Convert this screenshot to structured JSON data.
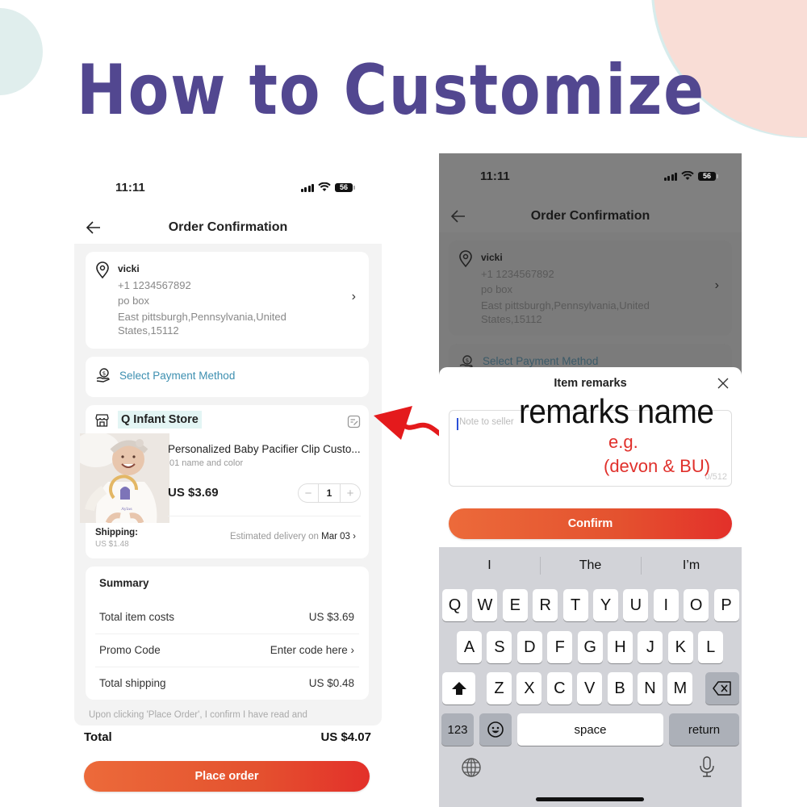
{
  "headline": "How to Customize",
  "colors": {
    "headline": "#524790",
    "accent_gradient_start": "#ec6a3a",
    "accent_gradient_end": "#e3302a",
    "payment_link": "#3d8fb0",
    "annotation_red": "#e0302b"
  },
  "status_bar": {
    "time": "11:11",
    "battery": "56",
    "icons": [
      "signal-icon",
      "wifi-icon",
      "battery-icon"
    ]
  },
  "left_phone": {
    "nav": {
      "title": "Order Confirmation",
      "back_icon": "arrow-left-icon"
    },
    "address": {
      "name": "vicki",
      "phone": "+1 1234567892",
      "line1": "po box",
      "line2": "East pittsburgh,Pennsylvania,United",
      "line3": "States,15112",
      "icon": "location-pin-icon"
    },
    "payment": {
      "label": "Select Payment Method",
      "icon": "hand-dollar-icon"
    },
    "store": {
      "name": "Q Infant Store",
      "icon": "store-icon",
      "note_icon": "edit-note-icon",
      "product": {
        "title": "Personalized Baby Pacifier Clip Custo...",
        "variant": "01 name and color",
        "price": "US $3.69",
        "quantity": "1",
        "minus": "−",
        "plus": "+"
      },
      "shipping_label": "Shipping:",
      "shipping_value": "US $1.48",
      "delivery_prefix": "Estimated delivery on",
      "delivery_date": "Mar 03",
      "chevron": "›"
    },
    "summary": {
      "title": "Summary",
      "rows": [
        {
          "label": "Total item costs",
          "value": "US $3.69"
        },
        {
          "label": "Promo Code",
          "value": "Enter code here ›"
        },
        {
          "label": "Total shipping",
          "value": "US $0.48"
        }
      ]
    },
    "legal_text": "Upon clicking 'Place Order', I confirm I have read and",
    "total_label": "Total",
    "total_value": "US $4.07",
    "place_order": "Place order"
  },
  "right_phone": {
    "nav": {
      "title": "Order Confirmation"
    },
    "address": {
      "name": "vicki",
      "phone": "+1 1234567892",
      "line1": "po box",
      "line2": "East pittsburgh,Pennsylvania,United",
      "line3": "States,15112"
    },
    "payment_label": "Select Payment Method",
    "sheet": {
      "title": "Item remarks",
      "placeholder": "Note to seller",
      "counter": "0/512",
      "confirm": "Confirm"
    },
    "annotation": {
      "heading": "remarks name",
      "eg": "e.g.",
      "example": "(devon & BU)"
    },
    "keyboard": {
      "suggestions": [
        "I",
        "The",
        "I’m"
      ],
      "row1": [
        "Q",
        "W",
        "E",
        "R",
        "T",
        "Y",
        "U",
        "I",
        "O",
        "P"
      ],
      "row2": [
        "A",
        "S",
        "D",
        "F",
        "G",
        "H",
        "J",
        "K",
        "L"
      ],
      "row3": [
        "Z",
        "X",
        "C",
        "V",
        "B",
        "N",
        "M"
      ],
      "numbers": "123",
      "space": "space",
      "return": "return"
    }
  }
}
